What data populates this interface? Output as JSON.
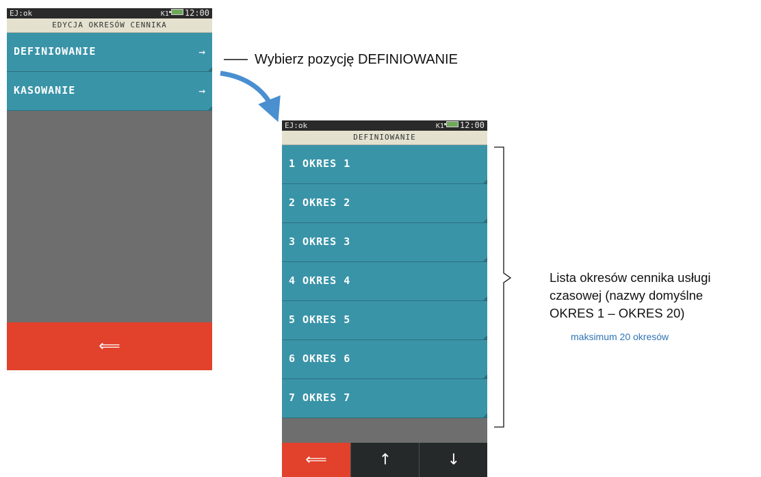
{
  "screen1": {
    "status": {
      "left": "EJ:ok",
      "k1": "K1",
      "clock": "12:00"
    },
    "title": "EDYCJA OKRESÓW CENNIKA",
    "items": [
      {
        "label": "DEFINIOWANIE",
        "arrow": "→"
      },
      {
        "label": "KASOWANIE",
        "arrow": "→"
      }
    ],
    "back_glyph": "⟸"
  },
  "screen2": {
    "status": {
      "left": "EJ:ok",
      "k1": "K1",
      "clock": "12:00"
    },
    "title": "DEFINIOWANIE",
    "items": [
      {
        "label": "1 OKRES 1"
      },
      {
        "label": "2 OKRES 2"
      },
      {
        "label": "3 OKRES 3"
      },
      {
        "label": "4 OKRES 4"
      },
      {
        "label": "5 OKRES 5"
      },
      {
        "label": "6 OKRES 6"
      },
      {
        "label": "7 OKRES 7"
      }
    ],
    "nav": {
      "back": "⟸",
      "up": "↑",
      "down": "↓"
    }
  },
  "annotations": {
    "definiowanie": "Wybierz pozycję DEFINIOWANIE",
    "list_line1": "Lista okresów cennika usługi",
    "list_line2": "czasowej (nazwy domyślne",
    "list_line3": "OKRES 1 – OKRES 20)",
    "maximum": "maksimum 20 okresów"
  },
  "colors": {
    "item": "#3a94a8",
    "back": "#e2412b",
    "arrow": "#4a8fd0",
    "note": "#2e74b5"
  }
}
